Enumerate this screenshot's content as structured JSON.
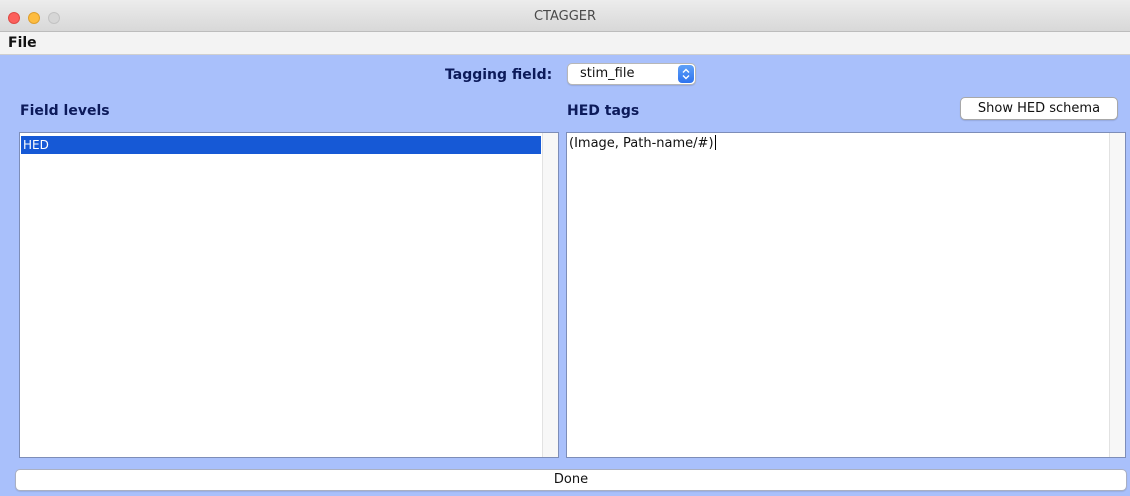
{
  "window": {
    "title": "CTAGGER"
  },
  "menu": {
    "file_label": "File"
  },
  "toolbar": {
    "tagging_field_label": "Tagging field:",
    "tagging_field_value": "stim_file"
  },
  "field_levels": {
    "label": "Field levels",
    "items": [
      "HED"
    ],
    "selected_index": 0
  },
  "hed_tags": {
    "label": "HED tags",
    "show_schema_label": "Show HED schema",
    "text": "(Image, Path-name/#)"
  },
  "footer": {
    "done_label": "Done"
  },
  "colors": {
    "window_background": "#a9c0fb",
    "selection": "#1659d6",
    "label_text": "#0c1a5a"
  },
  "icons": {
    "close": "close-circle",
    "minimize": "minimize-circle",
    "maximize": "maximize-circle",
    "dropdown": "chevron-up-down"
  }
}
